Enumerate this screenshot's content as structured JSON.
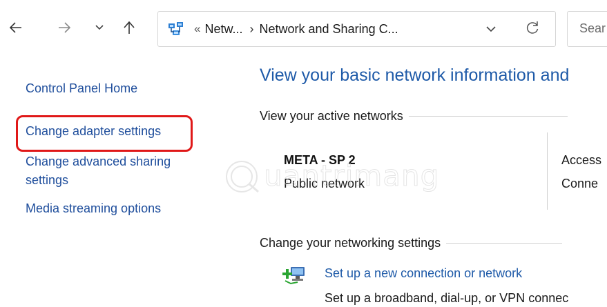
{
  "navigation": {
    "back_icon": "arrow-left-icon",
    "forward_icon": "arrow-right-icon",
    "recent_icon": "chevron-down-icon",
    "up_icon": "arrow-up-icon"
  },
  "address_bar": {
    "icon": "network-folder-icon",
    "overflow": "«",
    "crumbs": [
      "Netw...",
      "Network and Sharing C..."
    ],
    "separator": "›",
    "dropdown_icon": "chevron-down-icon",
    "refresh_icon": "refresh-icon"
  },
  "search": {
    "placeholder": "Sear"
  },
  "left_pane": {
    "links": [
      "Control Panel Home",
      "Change adapter settings",
      "Change advanced sharing",
      "settings",
      "Media streaming options"
    ],
    "highlight_color": "#e01818"
  },
  "main": {
    "title": "View your basic network information and",
    "active_networks_label": "View your active networks",
    "network": {
      "name": "META - SP 2",
      "type": "Public network",
      "access_label": "Access",
      "connections_label": "Conne"
    },
    "change_settings_label": "Change your networking settings",
    "setup": {
      "icon": "new-connection-icon",
      "link": "Set up a new connection or network",
      "description": "Set up a broadband, dial-up, or VPN connec"
    }
  },
  "watermark": {
    "text": "uantrimang",
    "mark": "Q"
  },
  "colors": {
    "link": "#1f4e9c",
    "title": "#1e5aa8",
    "highlight": "#e01818"
  }
}
